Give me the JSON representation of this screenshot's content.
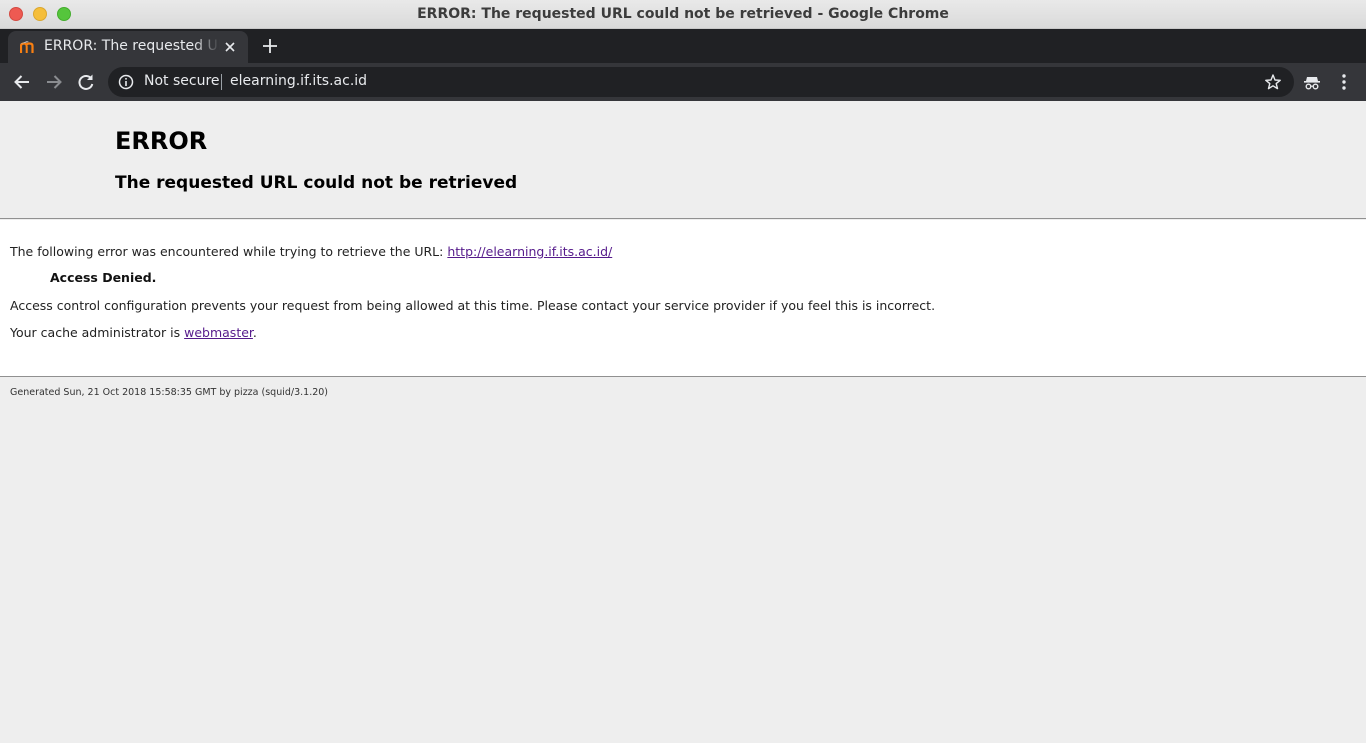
{
  "window": {
    "title": "ERROR: The requested URL could not be retrieved - Google Chrome"
  },
  "tab": {
    "title": "ERROR: The requested URL could not be retrieved",
    "favicon": "moodle-logo-icon"
  },
  "toolbar": {
    "security_label": "Not secure",
    "url": "elearning.if.its.ac.id"
  },
  "page": {
    "heading": "ERROR",
    "subheading": "The requested URL could not be retrieved",
    "intro_text": "The following error was encountered while trying to retrieve the URL: ",
    "intro_link": "http://elearning.if.its.ac.id/",
    "error_title": "Access Denied.",
    "error_detail": "Access control configuration prevents your request from being allowed at this time. Please contact your service provider if you feel this is incorrect.",
    "admin_text": "Your cache administrator is ",
    "admin_link": "webmaster",
    "admin_suffix": ".",
    "footer": "Generated Sun, 21 Oct 2018 15:58:35 GMT by pizza (squid/3.1.20)"
  },
  "colors": {
    "link": "#551a8b",
    "tab_strip": "#202124",
    "toolbar": "#35363a"
  }
}
